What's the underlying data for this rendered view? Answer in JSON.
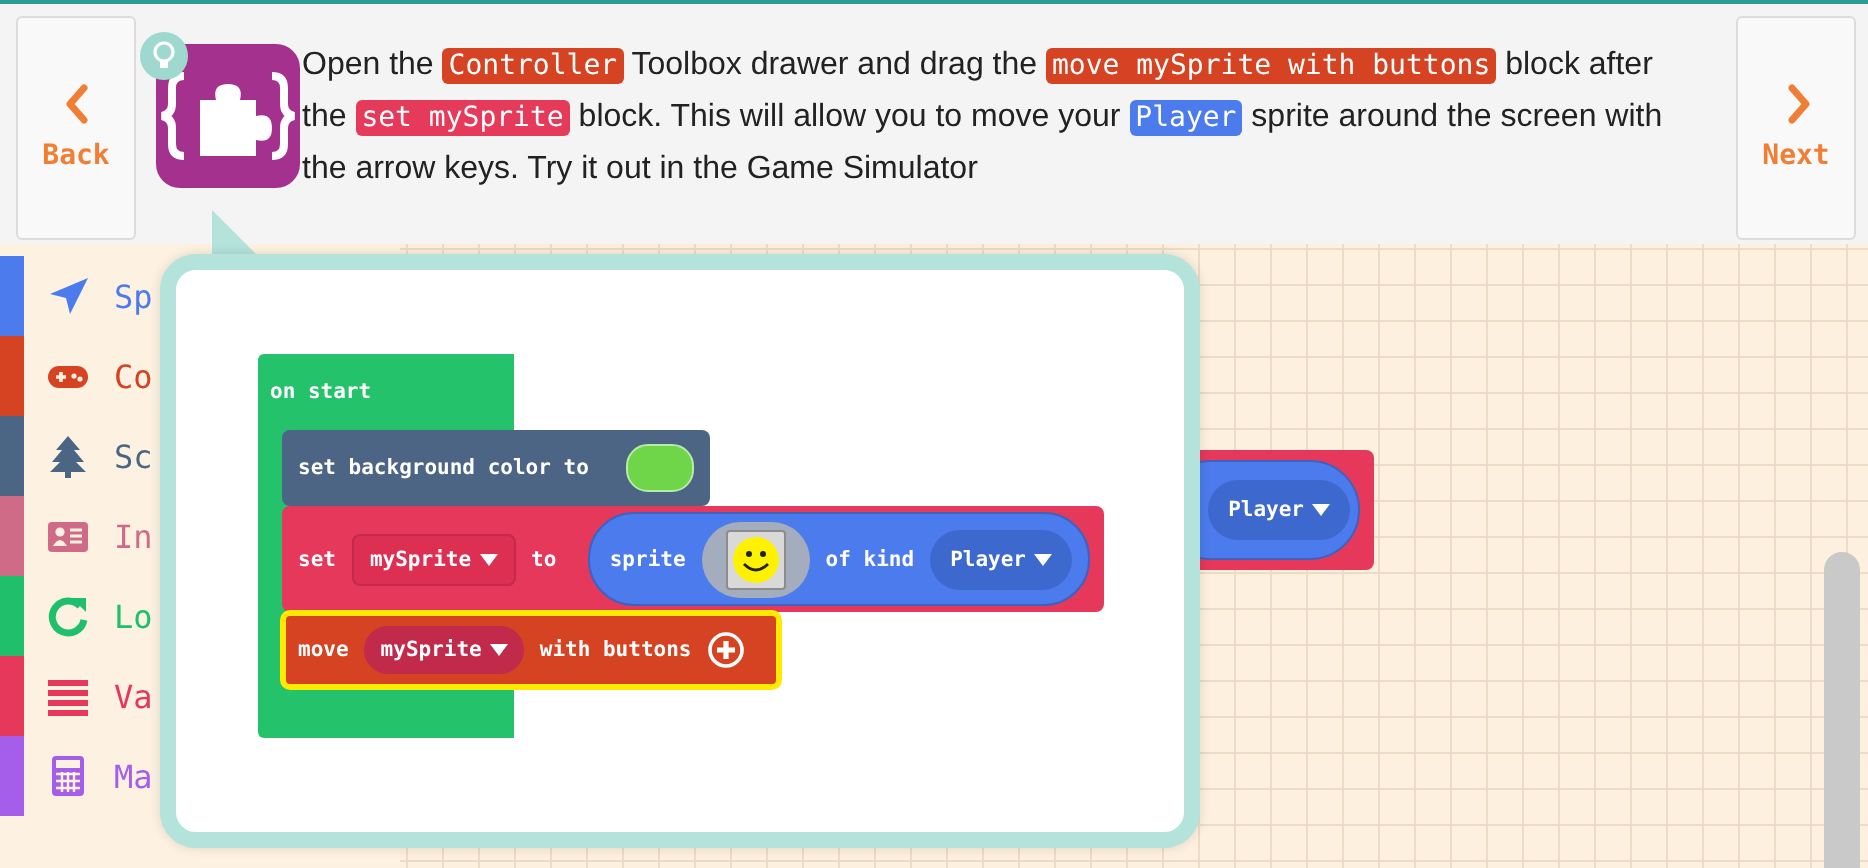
{
  "header": {
    "back": "Back",
    "next": "Next",
    "instruction": [
      {
        "kind": "text",
        "text": "Open the "
      },
      {
        "kind": "code",
        "text": "Controller",
        "color": "#d54322"
      },
      {
        "kind": "text",
        "text": " Toolbox drawer and drag the "
      },
      {
        "kind": "code",
        "text": "move mySprite with buttons",
        "color": "#d54322"
      },
      {
        "kind": "text",
        "text": " block after the "
      },
      {
        "kind": "code",
        "text": "set mySprite",
        "color": "#e63a5a"
      },
      {
        "kind": "text",
        "text": " block. This will allow you to move your "
      },
      {
        "kind": "code",
        "text": "Player",
        "color": "#4b7bec"
      },
      {
        "kind": "text",
        "text": " sprite around the screen with the arrow keys. Try it out in the Game Simulator"
      }
    ]
  },
  "toolbox": [
    {
      "name": "Sp",
      "color": "#4b7bec"
    },
    {
      "name": "Co",
      "color": "#d54322"
    },
    {
      "name": "Sc",
      "color": "#4b6584"
    },
    {
      "name": "In",
      "color": "#cf6a87"
    },
    {
      "name": "Lo",
      "color": "#20bf6b"
    },
    {
      "name": "Va",
      "color": "#e6385a"
    },
    {
      "name": "Ma",
      "color": "#a55eea"
    }
  ],
  "workspace": {
    "block_value": "Player"
  },
  "hint": {
    "event": "on start",
    "statements": [
      {
        "kind": "background",
        "label": "set background color to",
        "color": "#6fd64a",
        "highlighted": false
      },
      {
        "kind": "set",
        "label": "set",
        "variable": "mySprite",
        "to": "to",
        "sprite": "sprite",
        "of_kind": "of kind",
        "value": "Player",
        "highlighted": false
      },
      {
        "kind": "move",
        "label": "move",
        "variable": "mySprite",
        "suffix": "with buttons",
        "highlighted": true
      }
    ]
  }
}
